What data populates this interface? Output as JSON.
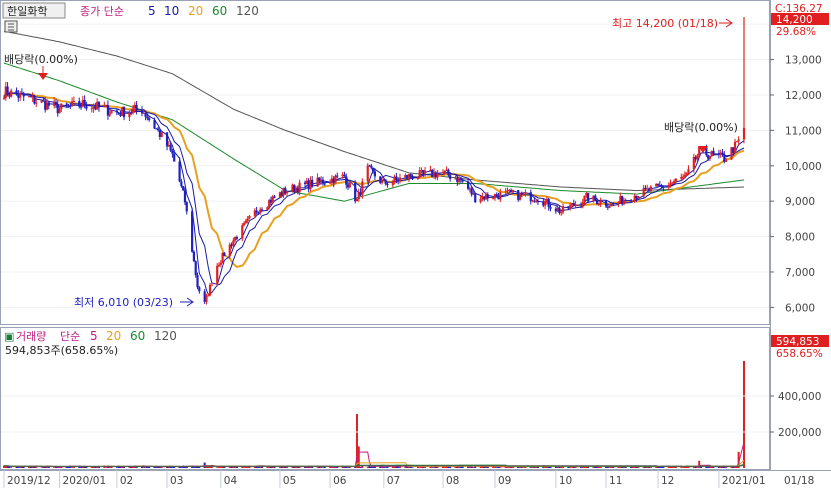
{
  "header": {
    "stock_name": "한일화학",
    "series_label": "종가 단순",
    "ma_periods": [
      "5",
      "10",
      "20",
      "60",
      "120"
    ],
    "ma_colors": [
      "#1a1aa8",
      "#1a1aa8",
      "#e8a020",
      "#1a8a2a",
      "#555555"
    ]
  },
  "price_panel": {
    "max_annotation": "최고 14,200 (01/18)",
    "min_annotation": "최저 6,010 (03/23)",
    "dividend_labels": [
      "배당락(0.00%)",
      "배당락(0.00%)"
    ],
    "corner_value": "C:136.27",
    "current_price_badge": "14,200",
    "current_pct": "29.68%",
    "y_ticks": [
      "13,000",
      "12,000",
      "11,000",
      "10,000",
      "9,000",
      "8,000",
      "7,000",
      "6,000"
    ]
  },
  "volume_panel": {
    "title": "거래량",
    "series_label": "단순",
    "ma_periods": [
      "5",
      "20",
      "60",
      "120"
    ],
    "ma_colors": [
      "#c02080",
      "#e8a020",
      "#1a8a2a",
      "#555555"
    ],
    "current_volume_text": "594,853주(658.65%)",
    "badge_volume": "594,853",
    "badge_pct": "658.65%",
    "y_ticks": [
      "400,000",
      "200,000"
    ]
  },
  "x_axis": {
    "labels": [
      "2019/12",
      "2020/01",
      "02",
      "03",
      "04",
      "05",
      "06",
      "07",
      "08",
      "09",
      "10",
      "11",
      "12",
      "2021/01"
    ],
    "right_label": "01/18"
  },
  "colors": {
    "up": "#e02020",
    "down": "#2020c0",
    "accent": "#e02020"
  },
  "chart_data": {
    "type": "candlestick",
    "x_range": [
      "2019-12-02",
      "2021-01-18"
    ],
    "ylim": [
      5700,
      14400
    ],
    "volume_ylim": [
      0,
      600000
    ],
    "close_anchors": [
      {
        "date": "2019-12-02",
        "close": 12100
      },
      {
        "date": "2019-12-16",
        "close": 11900
      },
      {
        "date": "2020-01-02",
        "close": 11600
      },
      {
        "date": "2020-01-16",
        "close": 11750
      },
      {
        "date": "2020-02-03",
        "close": 11500
      },
      {
        "date": "2020-02-17",
        "close": 11600
      },
      {
        "date": "2020-02-27",
        "close": 10900
      },
      {
        "date": "2020-03-05",
        "close": 10300
      },
      {
        "date": "2020-03-12",
        "close": 9000
      },
      {
        "date": "2020-03-19",
        "close": 6600
      },
      {
        "date": "2020-03-23",
        "close": 6100
      },
      {
        "date": "2020-03-30",
        "close": 7200
      },
      {
        "date": "2020-04-08",
        "close": 7900
      },
      {
        "date": "2020-04-22",
        "close": 8800
      },
      {
        "date": "2020-05-07",
        "close": 9300
      },
      {
        "date": "2020-05-22",
        "close": 9500
      },
      {
        "date": "2020-06-09",
        "close": 9700
      },
      {
        "date": "2020-06-16",
        "close": 9000
      },
      {
        "date": "2020-06-22",
        "close": 9900
      },
      {
        "date": "2020-07-01",
        "close": 9500
      },
      {
        "date": "2020-07-15",
        "close": 9700
      },
      {
        "date": "2020-08-03",
        "close": 9800
      },
      {
        "date": "2020-08-13",
        "close": 9600
      },
      {
        "date": "2020-08-21",
        "close": 9100
      },
      {
        "date": "2020-09-09",
        "close": 9200
      },
      {
        "date": "2020-09-25",
        "close": 9100
      },
      {
        "date": "2020-10-08",
        "close": 8700
      },
      {
        "date": "2020-10-22",
        "close": 9100
      },
      {
        "date": "2020-11-05",
        "close": 8900
      },
      {
        "date": "2020-11-19",
        "close": 9200
      },
      {
        "date": "2020-12-03",
        "close": 9400
      },
      {
        "date": "2020-12-17",
        "close": 9700
      },
      {
        "date": "2020-12-24",
        "close": 10400
      },
      {
        "date": "2021-01-07",
        "close": 10200
      },
      {
        "date": "2021-01-14",
        "close": 10600
      },
      {
        "date": "2021-01-18",
        "close": 11000
      }
    ],
    "ma60_anchors": [
      {
        "date": "2019-12-02",
        "value": 12900
      },
      {
        "date": "2020-01-02",
        "value": 12400
      },
      {
        "date": "2020-02-03",
        "value": 11800
      },
      {
        "date": "2020-03-05",
        "value": 11300
      },
      {
        "date": "2020-04-08",
        "value": 10200
      },
      {
        "date": "2020-05-07",
        "value": 9300
      },
      {
        "date": "2020-06-09",
        "value": 9000
      },
      {
        "date": "2020-07-15",
        "value": 9500
      },
      {
        "date": "2020-08-21",
        "value": 9500
      },
      {
        "date": "2020-10-08",
        "value": 9300
      },
      {
        "date": "2020-11-19",
        "value": 9200
      },
      {
        "date": "2021-01-18",
        "value": 9600
      }
    ],
    "ma120_anchors": [
      {
        "date": "2019-12-02",
        "value": 13800
      },
      {
        "date": "2020-01-02",
        "value": 13500
      },
      {
        "date": "2020-02-03",
        "value": 13100
      },
      {
        "date": "2020-03-05",
        "value": 12600
      },
      {
        "date": "2020-04-08",
        "value": 11600
      },
      {
        "date": "2020-05-07",
        "value": 11000
      },
      {
        "date": "2020-06-09",
        "value": 10400
      },
      {
        "date": "2020-07-15",
        "value": 9800
      },
      {
        "date": "2020-08-21",
        "value": 9600
      },
      {
        "date": "2020-10-08",
        "value": 9400
      },
      {
        "date": "2020-11-19",
        "value": 9300
      },
      {
        "date": "2021-01-18",
        "value": 9400
      }
    ],
    "volume_peaks": [
      {
        "date": "2020-03-23",
        "volume": 30000
      },
      {
        "date": "2020-06-16",
        "volume": 300000
      },
      {
        "date": "2020-06-17",
        "volume": 120000
      },
      {
        "date": "2020-12-24",
        "volume": 40000
      },
      {
        "date": "2021-01-15",
        "volume": 90000
      },
      {
        "date": "2021-01-18",
        "volume": 594853
      }
    ],
    "max_point": {
      "date": "2021-01-18",
      "value": 14200
    },
    "min_point": {
      "date": "2020-03-23",
      "value": 6010
    }
  }
}
